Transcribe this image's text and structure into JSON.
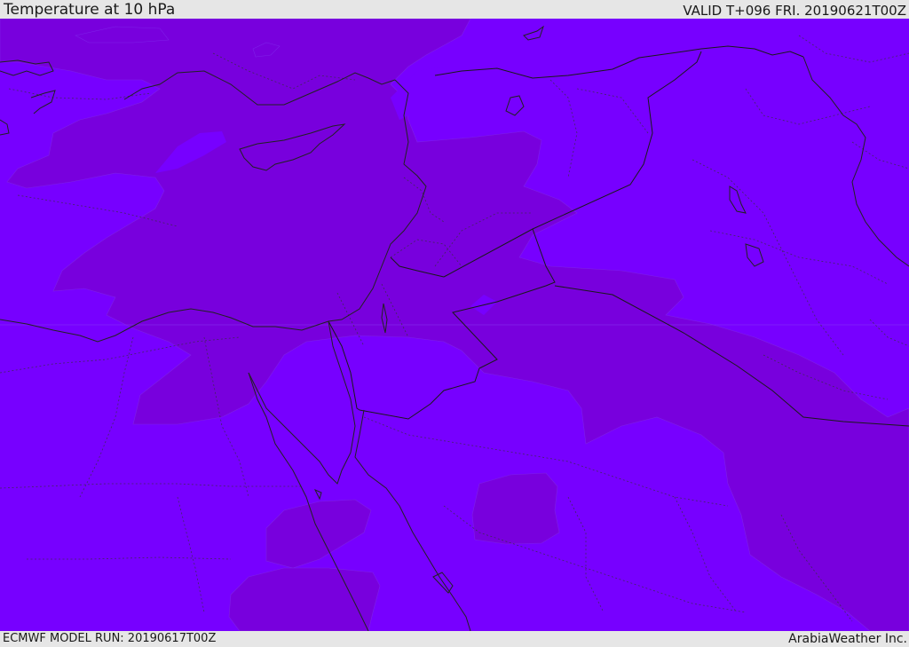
{
  "header": {
    "title": "Temperature at 10 hPa",
    "valid": "VALID T+096 FRI. 20190621T00Z"
  },
  "footer": {
    "model_run": "ECMWF MODEL RUN: 20190617T00Z",
    "credit": "ArabiaWeather Inc."
  },
  "map": {
    "background_color": "#7700ff",
    "contour_color": "#7800dd",
    "coastline_color": "#222222",
    "border_color": "#333333"
  }
}
